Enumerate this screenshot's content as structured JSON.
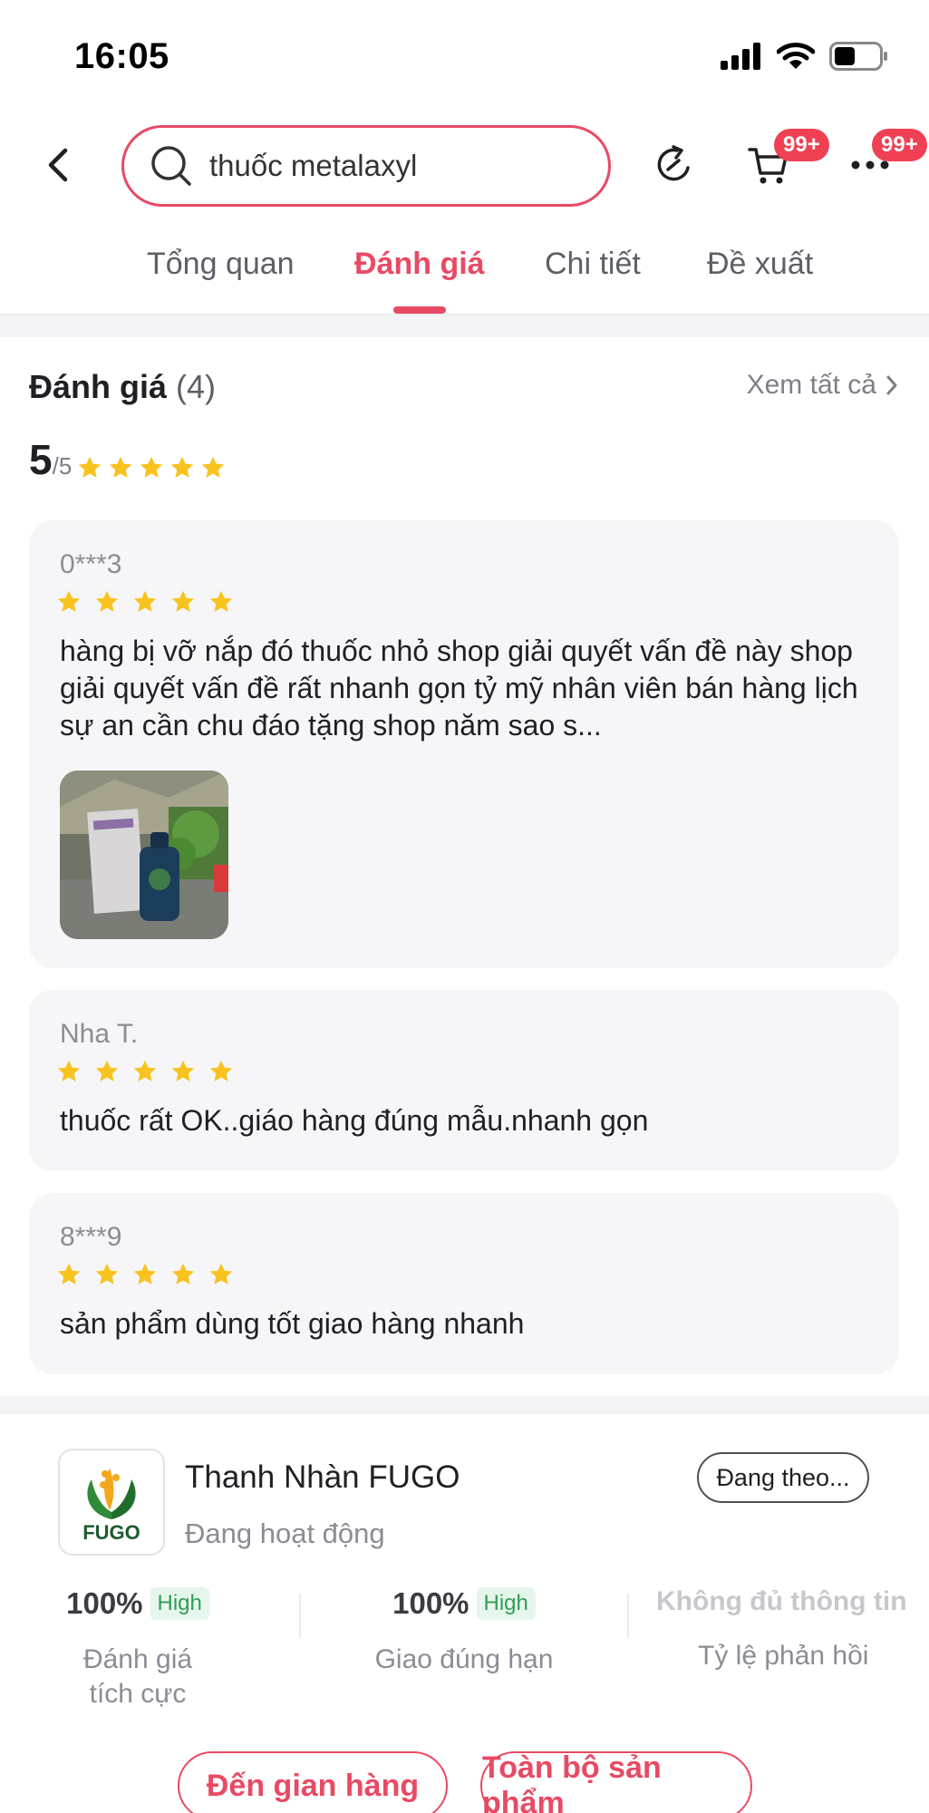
{
  "status_bar": {
    "time": "16:05"
  },
  "search": {
    "query": "thuốc metalaxyl"
  },
  "nav": {
    "cart_badge": "99+",
    "more_badge": "99+"
  },
  "tabs": [
    {
      "label": "Tổng quan"
    },
    {
      "label": "Đánh giá"
    },
    {
      "label": "Chi tiết"
    },
    {
      "label": "Đề xuất"
    }
  ],
  "reviews": {
    "title": "Đánh giá",
    "count": "(4)",
    "see_all": "Xem tất cả",
    "score": "5",
    "score_max": "/5",
    "rating": 5,
    "items": [
      {
        "user": "0***3",
        "stars": 5,
        "text": "hàng bị vỡ nắp đó thuốc nhỏ shop giải quyết vấn đề này shop giải quyết vấn đề rất nhanh gọn tỷ mỹ nhân viên bán hàng lịch sự an cần chu đáo tặng shop năm sao s..."
      },
      {
        "user": "Nha T.",
        "stars": 5,
        "text": "thuốc rất OK..giáo hàng đúng mẫu.nhanh gọn"
      },
      {
        "user": "8***9",
        "stars": 5,
        "text": "sản phẩm dùng tốt giao hàng nhanh"
      }
    ]
  },
  "shop": {
    "logo_text": "FUGO",
    "name": "Thanh Nhàn FUGO",
    "status": "Đang hoạt động",
    "follow_label": "Đang theo...",
    "metrics": [
      {
        "value": "100%",
        "tag": "High",
        "label_line1": "Đánh giá",
        "label_line2": "tích cực"
      },
      {
        "value": "100%",
        "tag": "High",
        "label_line1": "Giao đúng hạn"
      },
      {
        "value": "Không đủ thông tin",
        "label_line1": "Tỷ lệ phản hồi"
      }
    ],
    "store_button": "Đến gian hàng",
    "all_products_button": "Toàn bộ sản phẩm"
  },
  "colors": {
    "accent": "#e84a64",
    "star": "#f9c31f",
    "badge": "#ef4054",
    "tag_green": "#2f9e55"
  }
}
